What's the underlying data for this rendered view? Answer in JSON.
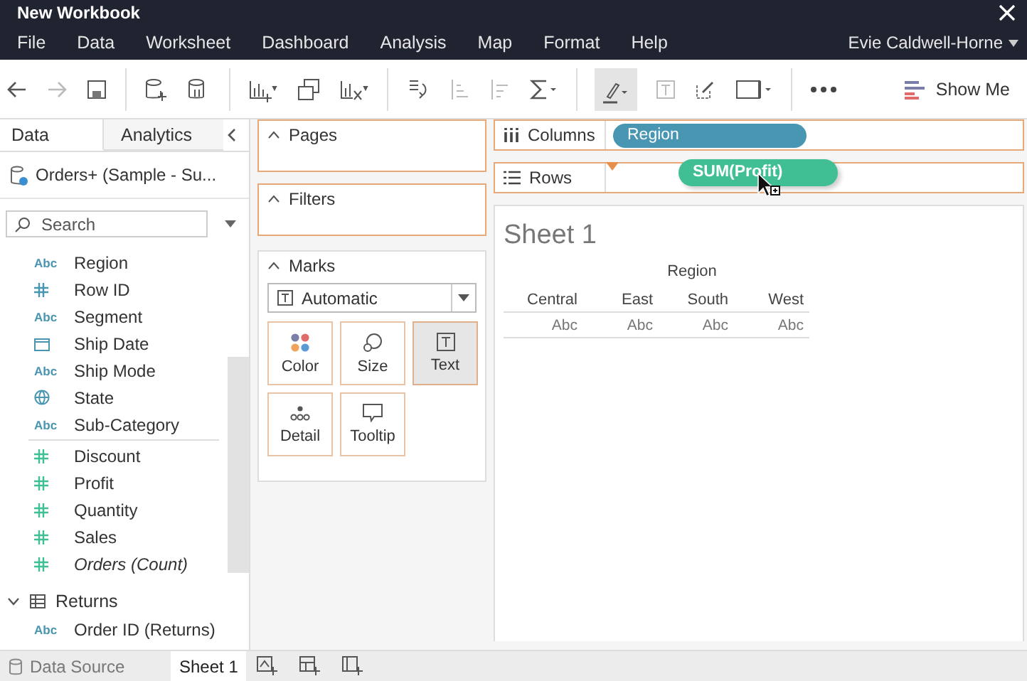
{
  "window": {
    "title": "New Workbook"
  },
  "menu": [
    "File",
    "Data",
    "Worksheet",
    "Dashboard",
    "Analysis",
    "Map",
    "Format",
    "Help"
  ],
  "user": {
    "name": "Evie Caldwell-Horne"
  },
  "toolbar": {
    "show_me": "Show Me"
  },
  "side_tabs": [
    {
      "label": "Data",
      "selected": true
    },
    {
      "label": "Analytics",
      "selected": false
    }
  ],
  "data_source": "Orders+ (Sample - Su...",
  "search": {
    "placeholder": "Search"
  },
  "fields": [
    {
      "name": "Region",
      "kind": "string",
      "icon_text": "Abc",
      "color": "#4996b2"
    },
    {
      "name": "Row ID",
      "kind": "number",
      "color": "#4996b2"
    },
    {
      "name": "Segment",
      "kind": "string",
      "icon_text": "Abc",
      "color": "#4996b2"
    },
    {
      "name": "Ship Date",
      "kind": "date",
      "color": "#4996b2"
    },
    {
      "name": "Ship Mode",
      "kind": "string",
      "icon_text": "Abc",
      "color": "#4996b2"
    },
    {
      "name": "State",
      "kind": "geo",
      "color": "#4996b2"
    },
    {
      "name": "Sub-Category",
      "kind": "string",
      "icon_text": "Abc",
      "color": "#4996b2"
    },
    {
      "name": "Discount",
      "kind": "number",
      "color": "#3fbf93"
    },
    {
      "name": "Profit",
      "kind": "number",
      "color": "#3fbf93"
    },
    {
      "name": "Quantity",
      "kind": "number",
      "color": "#3fbf93"
    },
    {
      "name": "Sales",
      "kind": "number",
      "color": "#3fbf93"
    },
    {
      "name": "Orders (Count)",
      "kind": "number",
      "color": "#3fbf93",
      "italic": true
    }
  ],
  "tables": [
    {
      "name": "Returns",
      "expanded": true,
      "fields": [
        {
          "name": "Order ID (Returns)",
          "icon_text": "Abc",
          "color": "#4996b2"
        }
      ]
    }
  ],
  "cards": {
    "pages": "Pages",
    "filters": "Filters"
  },
  "marks": {
    "title": "Marks",
    "mark_type": "Automatic",
    "buttons": [
      {
        "label": "Color",
        "kind": "color",
        "selected": false
      },
      {
        "label": "Size",
        "kind": "size",
        "selected": false
      },
      {
        "label": "Text",
        "kind": "text",
        "selected": true
      },
      {
        "label": "Detail",
        "kind": "detail",
        "selected": false
      },
      {
        "label": "Tooltip",
        "kind": "tooltip",
        "selected": false
      }
    ]
  },
  "shelves": [
    {
      "label": "Columns",
      "kind": "columns",
      "pills": [
        {
          "label": "Region",
          "color": "#4996b2"
        }
      ]
    },
    {
      "label": "Rows",
      "kind": "rows"
    }
  ],
  "drag_pill": {
    "label": "SUM(Profit)",
    "color": "#3fbf93"
  },
  "sheet": {
    "title": "Sheet 1",
    "column_header": "Region",
    "columns": [
      "Central",
      "East",
      "South",
      "West"
    ],
    "cells": [
      "Abc",
      "Abc",
      "Abc",
      "Abc"
    ]
  },
  "bottom_tabs": [
    {
      "label": "Data Source",
      "kind": "data_source",
      "selected": false
    },
    {
      "label": "Sheet 1",
      "kind": "sheet",
      "selected": true
    }
  ]
}
